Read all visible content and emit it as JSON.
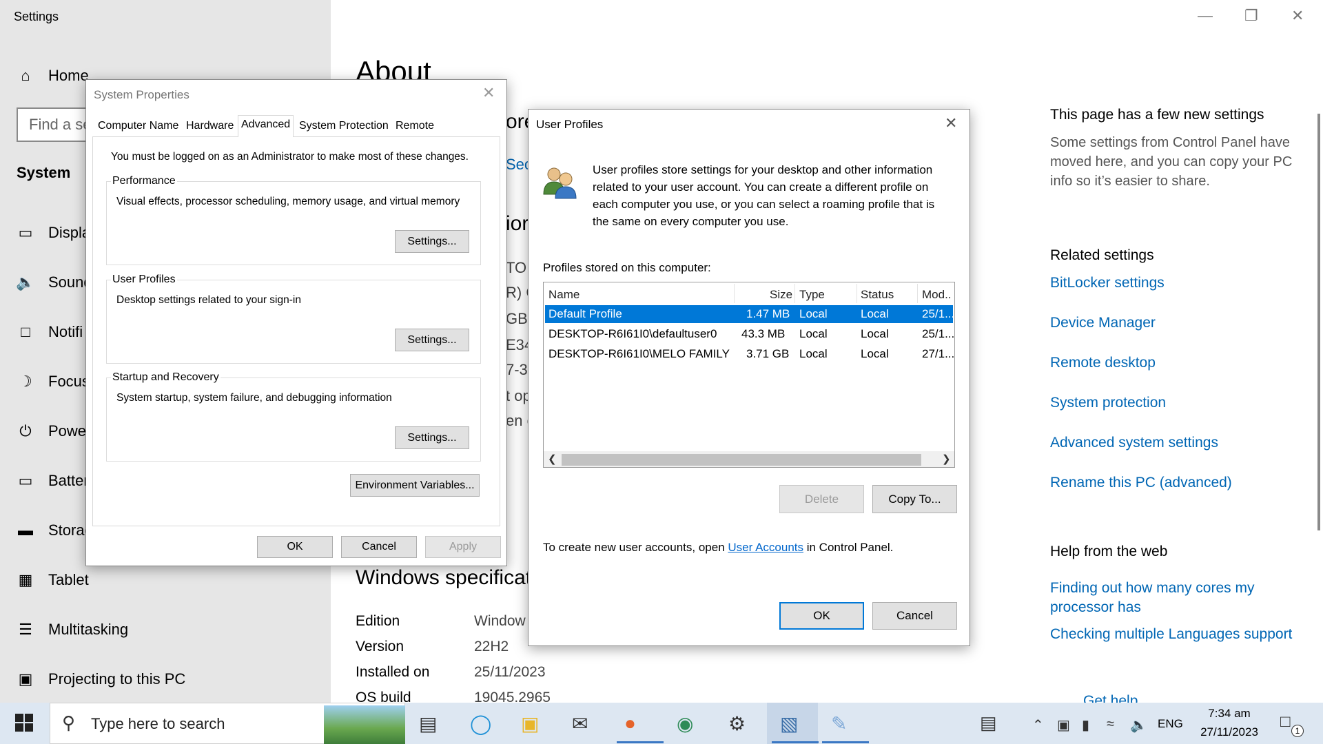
{
  "settings": {
    "app_title": "Settings",
    "find_placeholder": "Find a se",
    "home": "Home",
    "system": "System",
    "nav_items": [
      "Displa",
      "Sound",
      "Notifi",
      "Focus",
      "Power",
      "Batter",
      "Storag",
      "Tablet",
      "Multitasking",
      "Projecting to this PC"
    ],
    "about_title": "About",
    "fragments": [
      "ore",
      "Sec",
      "ior",
      "TO",
      "R) C",
      "GB",
      "E34",
      "7-3",
      "t op",
      "en c"
    ],
    "windows_spec_title": "Windows specificat",
    "spec": [
      {
        "k": "Edition",
        "v": "Window"
      },
      {
        "k": "Version",
        "v": "22H2"
      },
      {
        "k": "Installed on",
        "v": "25/11/2023"
      },
      {
        "k": "OS build",
        "v": "19045.2965"
      }
    ],
    "right_pane": {
      "new_settings_title": "This page has a few new settings",
      "new_settings_text": "Some settings from Control Panel have moved here, and you can copy your PC info so it’s easier to share.",
      "related_title": "Related settings",
      "related_links": [
        "BitLocker settings",
        "Device Manager",
        "Remote desktop",
        "System protection",
        "Advanced system settings",
        "Rename this PC (advanced)"
      ],
      "help_title": "Help from the web",
      "help_links": [
        "Finding out how many cores my processor has",
        "Checking multiple Languages support"
      ],
      "get_help": "Get help"
    }
  },
  "system_properties": {
    "title": "System Properties",
    "tabs": [
      "Computer Name",
      "Hardware",
      "Advanced",
      "System Protection",
      "Remote"
    ],
    "admin_note": "You must be logged on as an Administrator to make most of these changes.",
    "performance": {
      "label": "Performance",
      "text": "Visual effects, processor scheduling, memory usage, and virtual memory",
      "button": "Settings..."
    },
    "user_profiles": {
      "label": "User Profiles",
      "text": "Desktop settings related to your sign-in",
      "button": "Settings..."
    },
    "startup": {
      "label": "Startup and Recovery",
      "text": "System startup, system failure, and debugging information",
      "button": "Settings..."
    },
    "env_button": "Environment Variables...",
    "ok": "OK",
    "cancel": "Cancel",
    "apply": "Apply"
  },
  "user_profiles_dialog": {
    "title": "User Profiles",
    "description": "User profiles store settings for your desktop and other information related to your user account. You can create a different profile on each computer you use, or you can select a roaming profile that is the same on every computer you use.",
    "stored_label": "Profiles stored on this computer:",
    "columns": [
      "Name",
      "Size",
      "Type",
      "Status",
      "Mod..."
    ],
    "rows": [
      {
        "name": "Default Profile",
        "size": "1.47 MB",
        "type": "Local",
        "status": "Local",
        "mod": "25/1..."
      },
      {
        "name": "DESKTOP-R6I61I0\\defaultuser0",
        "size": "43.3 MB",
        "type": "Local",
        "status": "Local",
        "mod": "25/1..."
      },
      {
        "name": "DESKTOP-R6I61I0\\MELO FAMILY",
        "size": "3.71 GB",
        "type": "Local",
        "status": "Local",
        "mod": "27/1..."
      }
    ],
    "delete": "Delete",
    "copy_to": "Copy To...",
    "footer_pre": "To create new user accounts, open ",
    "footer_link": "User Accounts",
    "footer_post": " in Control Panel.",
    "ok": "OK",
    "cancel": "Cancel"
  },
  "taskbar": {
    "search_placeholder": "Type here to search",
    "language": "ENG",
    "time": "7:34 am",
    "date": "27/11/2023",
    "notification_count": "1"
  }
}
